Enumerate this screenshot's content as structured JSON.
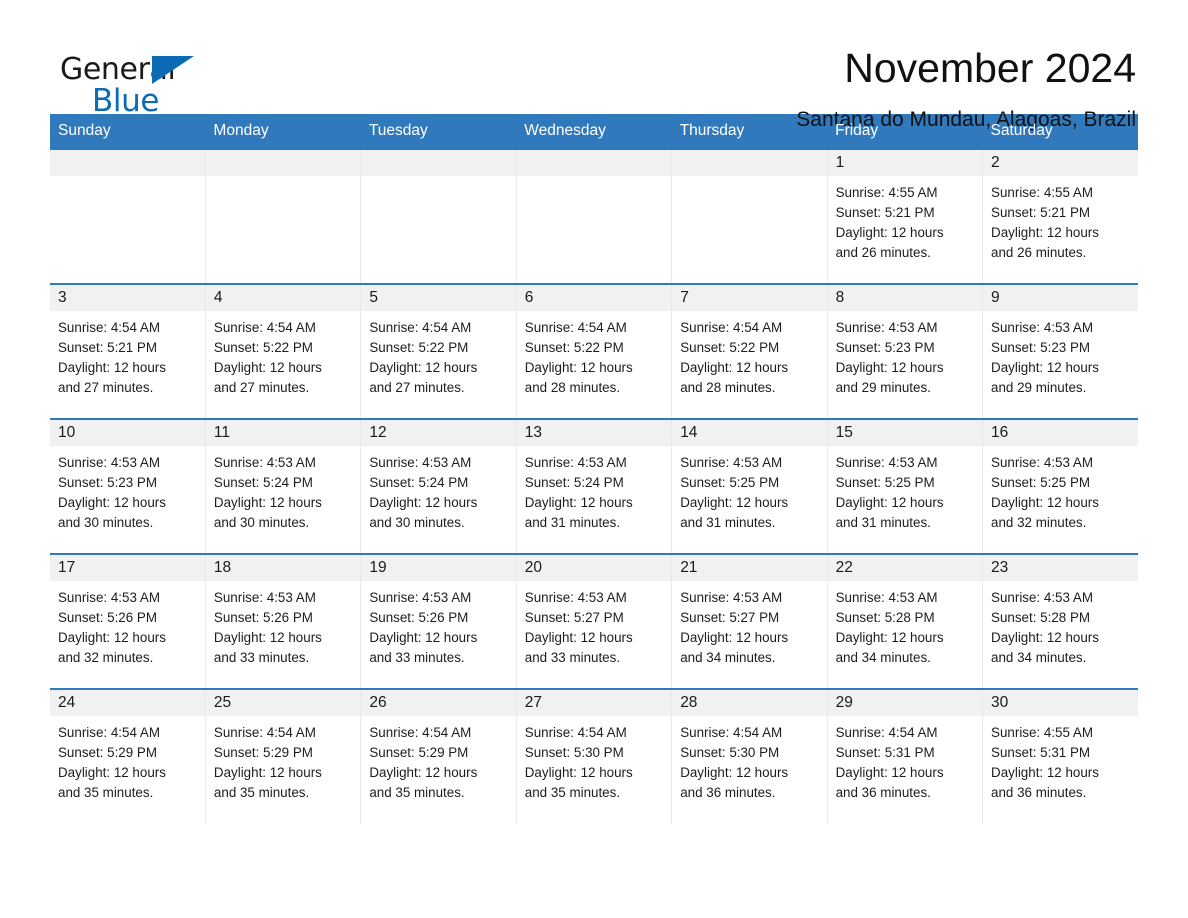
{
  "brand": {
    "name_part1": "General",
    "name_part2": "Blue",
    "accent_color": "#0b6bb5"
  },
  "header": {
    "month_title": "November 2024",
    "location": "Santana do Mundau, Alagoas, Brazil"
  },
  "calendar": {
    "header_color": "#3179bd",
    "weekday_headers": [
      "Sunday",
      "Monday",
      "Tuesday",
      "Wednesday",
      "Thursday",
      "Friday",
      "Saturday"
    ],
    "weeks": [
      [
        {
          "day": "",
          "sunrise": "",
          "sunset": "",
          "daylight1": "",
          "daylight2": ""
        },
        {
          "day": "",
          "sunrise": "",
          "sunset": "",
          "daylight1": "",
          "daylight2": ""
        },
        {
          "day": "",
          "sunrise": "",
          "sunset": "",
          "daylight1": "",
          "daylight2": ""
        },
        {
          "day": "",
          "sunrise": "",
          "sunset": "",
          "daylight1": "",
          "daylight2": ""
        },
        {
          "day": "",
          "sunrise": "",
          "sunset": "",
          "daylight1": "",
          "daylight2": ""
        },
        {
          "day": "1",
          "sunrise": "Sunrise: 4:55 AM",
          "sunset": "Sunset: 5:21 PM",
          "daylight1": "Daylight: 12 hours",
          "daylight2": "and 26 minutes."
        },
        {
          "day": "2",
          "sunrise": "Sunrise: 4:55 AM",
          "sunset": "Sunset: 5:21 PM",
          "daylight1": "Daylight: 12 hours",
          "daylight2": "and 26 minutes."
        }
      ],
      [
        {
          "day": "3",
          "sunrise": "Sunrise: 4:54 AM",
          "sunset": "Sunset: 5:21 PM",
          "daylight1": "Daylight: 12 hours",
          "daylight2": "and 27 minutes."
        },
        {
          "day": "4",
          "sunrise": "Sunrise: 4:54 AM",
          "sunset": "Sunset: 5:22 PM",
          "daylight1": "Daylight: 12 hours",
          "daylight2": "and 27 minutes."
        },
        {
          "day": "5",
          "sunrise": "Sunrise: 4:54 AM",
          "sunset": "Sunset: 5:22 PM",
          "daylight1": "Daylight: 12 hours",
          "daylight2": "and 27 minutes."
        },
        {
          "day": "6",
          "sunrise": "Sunrise: 4:54 AM",
          "sunset": "Sunset: 5:22 PM",
          "daylight1": "Daylight: 12 hours",
          "daylight2": "and 28 minutes."
        },
        {
          "day": "7",
          "sunrise": "Sunrise: 4:54 AM",
          "sunset": "Sunset: 5:22 PM",
          "daylight1": "Daylight: 12 hours",
          "daylight2": "and 28 minutes."
        },
        {
          "day": "8",
          "sunrise": "Sunrise: 4:53 AM",
          "sunset": "Sunset: 5:23 PM",
          "daylight1": "Daylight: 12 hours",
          "daylight2": "and 29 minutes."
        },
        {
          "day": "9",
          "sunrise": "Sunrise: 4:53 AM",
          "sunset": "Sunset: 5:23 PM",
          "daylight1": "Daylight: 12 hours",
          "daylight2": "and 29 minutes."
        }
      ],
      [
        {
          "day": "10",
          "sunrise": "Sunrise: 4:53 AM",
          "sunset": "Sunset: 5:23 PM",
          "daylight1": "Daylight: 12 hours",
          "daylight2": "and 30 minutes."
        },
        {
          "day": "11",
          "sunrise": "Sunrise: 4:53 AM",
          "sunset": "Sunset: 5:24 PM",
          "daylight1": "Daylight: 12 hours",
          "daylight2": "and 30 minutes."
        },
        {
          "day": "12",
          "sunrise": "Sunrise: 4:53 AM",
          "sunset": "Sunset: 5:24 PM",
          "daylight1": "Daylight: 12 hours",
          "daylight2": "and 30 minutes."
        },
        {
          "day": "13",
          "sunrise": "Sunrise: 4:53 AM",
          "sunset": "Sunset: 5:24 PM",
          "daylight1": "Daylight: 12 hours",
          "daylight2": "and 31 minutes."
        },
        {
          "day": "14",
          "sunrise": "Sunrise: 4:53 AM",
          "sunset": "Sunset: 5:25 PM",
          "daylight1": "Daylight: 12 hours",
          "daylight2": "and 31 minutes."
        },
        {
          "day": "15",
          "sunrise": "Sunrise: 4:53 AM",
          "sunset": "Sunset: 5:25 PM",
          "daylight1": "Daylight: 12 hours",
          "daylight2": "and 31 minutes."
        },
        {
          "day": "16",
          "sunrise": "Sunrise: 4:53 AM",
          "sunset": "Sunset: 5:25 PM",
          "daylight1": "Daylight: 12 hours",
          "daylight2": "and 32 minutes."
        }
      ],
      [
        {
          "day": "17",
          "sunrise": "Sunrise: 4:53 AM",
          "sunset": "Sunset: 5:26 PM",
          "daylight1": "Daylight: 12 hours",
          "daylight2": "and 32 minutes."
        },
        {
          "day": "18",
          "sunrise": "Sunrise: 4:53 AM",
          "sunset": "Sunset: 5:26 PM",
          "daylight1": "Daylight: 12 hours",
          "daylight2": "and 33 minutes."
        },
        {
          "day": "19",
          "sunrise": "Sunrise: 4:53 AM",
          "sunset": "Sunset: 5:26 PM",
          "daylight1": "Daylight: 12 hours",
          "daylight2": "and 33 minutes."
        },
        {
          "day": "20",
          "sunrise": "Sunrise: 4:53 AM",
          "sunset": "Sunset: 5:27 PM",
          "daylight1": "Daylight: 12 hours",
          "daylight2": "and 33 minutes."
        },
        {
          "day": "21",
          "sunrise": "Sunrise: 4:53 AM",
          "sunset": "Sunset: 5:27 PM",
          "daylight1": "Daylight: 12 hours",
          "daylight2": "and 34 minutes."
        },
        {
          "day": "22",
          "sunrise": "Sunrise: 4:53 AM",
          "sunset": "Sunset: 5:28 PM",
          "daylight1": "Daylight: 12 hours",
          "daylight2": "and 34 minutes."
        },
        {
          "day": "23",
          "sunrise": "Sunrise: 4:53 AM",
          "sunset": "Sunset: 5:28 PM",
          "daylight1": "Daylight: 12 hours",
          "daylight2": "and 34 minutes."
        }
      ],
      [
        {
          "day": "24",
          "sunrise": "Sunrise: 4:54 AM",
          "sunset": "Sunset: 5:29 PM",
          "daylight1": "Daylight: 12 hours",
          "daylight2": "and 35 minutes."
        },
        {
          "day": "25",
          "sunrise": "Sunrise: 4:54 AM",
          "sunset": "Sunset: 5:29 PM",
          "daylight1": "Daylight: 12 hours",
          "daylight2": "and 35 minutes."
        },
        {
          "day": "26",
          "sunrise": "Sunrise: 4:54 AM",
          "sunset": "Sunset: 5:29 PM",
          "daylight1": "Daylight: 12 hours",
          "daylight2": "and 35 minutes."
        },
        {
          "day": "27",
          "sunrise": "Sunrise: 4:54 AM",
          "sunset": "Sunset: 5:30 PM",
          "daylight1": "Daylight: 12 hours",
          "daylight2": "and 35 minutes."
        },
        {
          "day": "28",
          "sunrise": "Sunrise: 4:54 AM",
          "sunset": "Sunset: 5:30 PM",
          "daylight1": "Daylight: 12 hours",
          "daylight2": "and 36 minutes."
        },
        {
          "day": "29",
          "sunrise": "Sunrise: 4:54 AM",
          "sunset": "Sunset: 5:31 PM",
          "daylight1": "Daylight: 12 hours",
          "daylight2": "and 36 minutes."
        },
        {
          "day": "30",
          "sunrise": "Sunrise: 4:55 AM",
          "sunset": "Sunset: 5:31 PM",
          "daylight1": "Daylight: 12 hours",
          "daylight2": "and 36 minutes."
        }
      ]
    ]
  }
}
